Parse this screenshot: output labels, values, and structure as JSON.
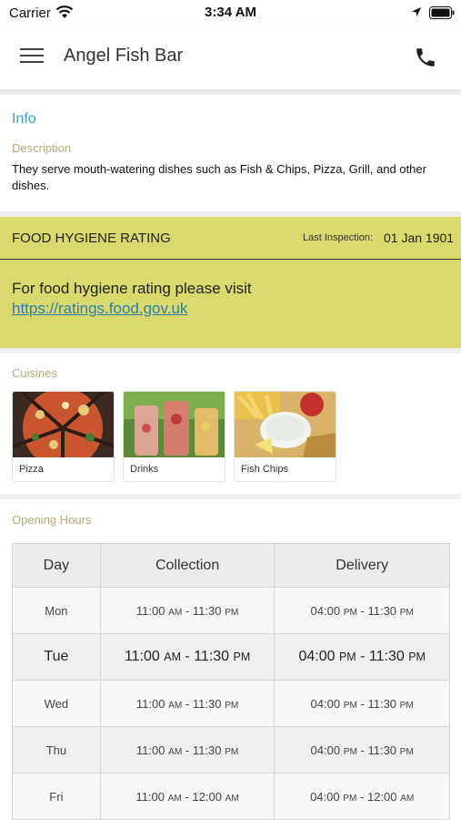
{
  "status_bar": {
    "carrier": "Carrier",
    "time": "3:34 AM"
  },
  "nav": {
    "title": "Angel Fish Bar",
    "menu_icon": "hamburger-menu-icon",
    "phone_icon": "phone-icon"
  },
  "info": {
    "heading": "Info",
    "description_label": "Description",
    "description": "They serve mouth-watering dishes such as Fish & Chips, Pizza, Grill,  and other dishes."
  },
  "hygiene": {
    "title": "FOOD HYGIENE RATING",
    "last_inspection_label": "Last Inspection:",
    "last_inspection_date": "01 Jan 1901",
    "visit_text": "For food hygiene rating please visit",
    "link": "https://ratings.food.gov.uk"
  },
  "cuisines": {
    "label": "Cuisines",
    "items": [
      {
        "name": "Pizza"
      },
      {
        "name": "Drinks"
      },
      {
        "name": "Fish  Chips"
      }
    ]
  },
  "opening_hours": {
    "label": "Opening Hours",
    "columns": [
      "Day",
      "Collection",
      "Delivery"
    ],
    "rows": [
      {
        "day": "Mon",
        "c_open": "11:00",
        "c_open_p": "AM",
        "c_close": "11:30",
        "c_close_p": "PM",
        "d_open": "04:00",
        "d_open_p": "PM",
        "d_close": "11:30",
        "d_close_p": "PM"
      },
      {
        "day": "Tue",
        "c_open": "11:00",
        "c_open_p": "AM",
        "c_close": "11:30",
        "c_close_p": "PM",
        "d_open": "04:00",
        "d_open_p": "PM",
        "d_close": "11:30",
        "d_close_p": "PM"
      },
      {
        "day": "Wed",
        "c_open": "11:00",
        "c_open_p": "AM",
        "c_close": "11:30",
        "c_close_p": "PM",
        "d_open": "04:00",
        "d_open_p": "PM",
        "d_close": "11:30",
        "d_close_p": "PM"
      },
      {
        "day": "Thu",
        "c_open": "11:00",
        "c_open_p": "AM",
        "c_close": "11:30",
        "c_close_p": "PM",
        "d_open": "04:00",
        "d_open_p": "PM",
        "d_close": "11:30",
        "d_close_p": "PM"
      },
      {
        "day": "Fri",
        "c_open": "11:00",
        "c_open_p": "AM",
        "c_close": "12:00",
        "c_close_p": "AM",
        "d_open": "04:00",
        "d_open_p": "PM",
        "d_close": "12:00",
        "d_close_p": "AM"
      }
    ],
    "separator": " - "
  },
  "colors": {
    "accent": "#3ba0c9",
    "section_label": "#b5a876",
    "hygiene_bg": "#d9da6e",
    "link": "#2a7fae"
  }
}
